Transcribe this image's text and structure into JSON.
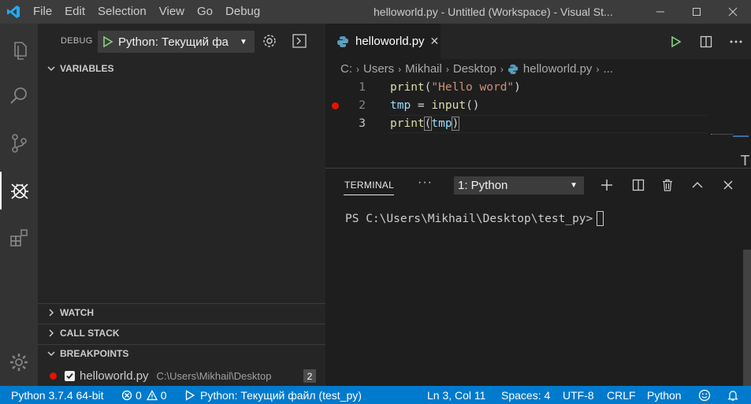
{
  "titlebar": {
    "menu": [
      "File",
      "Edit",
      "Selection",
      "View",
      "Go",
      "Debug"
    ],
    "title": "helloworld.py - Untitled (Workspace) - Visual St..."
  },
  "sidebar": {
    "header_label": "DEBUG",
    "debug_config": "Python: Текущий фа",
    "sections": {
      "variables": "VARIABLES",
      "watch": "WATCH",
      "call_stack": "CALL STACK",
      "breakpoints": "BREAKPOINTS"
    },
    "breakpoint": {
      "file": "helloworld.py",
      "path": "C:\\Users\\Mikhail\\Desktop",
      "count": "2",
      "checked": true
    }
  },
  "editor": {
    "tab_label": "helloworld.py",
    "breadcrumb": [
      "C:",
      "Users",
      "Mikhail",
      "Desktop",
      "helloworld.py",
      "..."
    ],
    "lines": [
      {
        "number": "1",
        "breakpoint": false
      },
      {
        "number": "2",
        "breakpoint": true
      },
      {
        "number": "3",
        "breakpoint": false,
        "current": true
      }
    ],
    "code": {
      "l1_fn": "print",
      "l1_open": "(",
      "l1_str": "\"Hello word\"",
      "l1_close": ")",
      "l2_var": "tmp",
      "l2_eq": " = ",
      "l2_fn": "input",
      "l2_paren": "()",
      "l3_fn": "print",
      "l3_open": "(",
      "l3_var": "tmp",
      "l3_close": ")"
    }
  },
  "panel": {
    "tab_label": "TERMINAL",
    "more_label": "···",
    "terminal_select": "1: Python",
    "prompt": "PS C:\\Users\\Mikhail\\Desktop\\test_py>"
  },
  "statusbar": {
    "python_version": "Python 3.7.4 64-bit",
    "errors": "0",
    "warnings": "0",
    "debug_config": "Python: Текущий файл (test_py)",
    "position": "Ln 3, Col 11",
    "spaces": "Spaces: 4",
    "encoding": "UTF-8",
    "eol": "CRLF",
    "language": "Python"
  },
  "colors": {
    "statusbar": "#007acc",
    "breakpoint": "#e51400",
    "run_green": "#89d185"
  }
}
